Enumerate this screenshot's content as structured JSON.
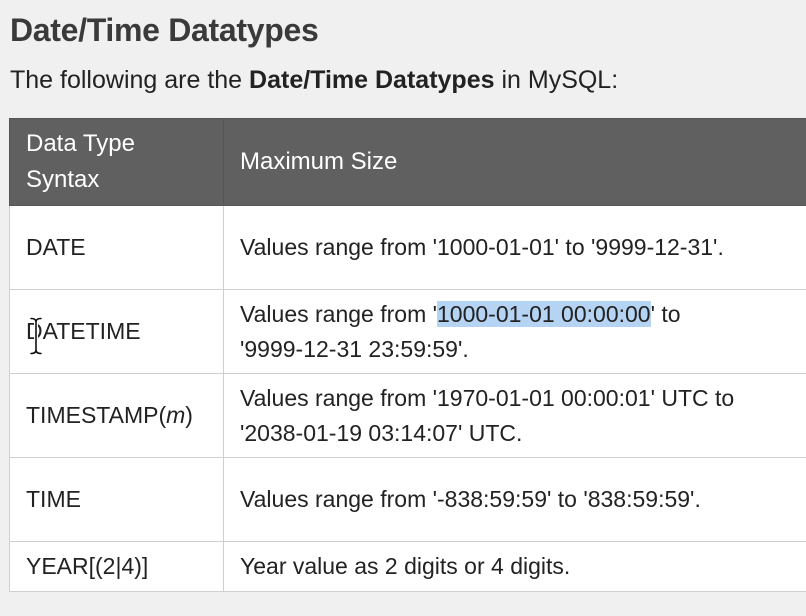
{
  "heading": "Date/Time Datatypes",
  "intro": {
    "prefix": "The following are the ",
    "bold": "Date/Time Datatypes",
    "suffix": " in MySQL:"
  },
  "table": {
    "headers": {
      "col1_line1": "Data Type",
      "col1_line2": "Syntax",
      "col2": "Maximum Size"
    },
    "rows": [
      {
        "type": "DATE",
        "desc_line1": "Values range from '1000-01-01' to '9999-12-31'."
      },
      {
        "type": "DATETIME",
        "desc_line1_pre": "Values range from '",
        "desc_line1_sel": "1000-01-01 00:00:00",
        "desc_line1_post": "' to",
        "desc_line2": "'9999-12-31 23:59:59'."
      },
      {
        "type_pre": "TIMESTAMP(",
        "type_italic": "m",
        "type_post": ")",
        "desc_line1": "Values range from '1970-01-01 00:00:01' UTC to",
        "desc_line2": "'2038-01-19 03:14:07' UTC."
      },
      {
        "type": "TIME",
        "desc_line1": "Values range from '-838:59:59' to '838:59:59'."
      },
      {
        "type": "YEAR[(2|4)]",
        "desc_line1": "Year value as 2 digits or 4 digits."
      }
    ]
  },
  "colors": {
    "header_bg": "#606060",
    "selection": "#b5d3f3",
    "page_bg": "#f0f0f0"
  },
  "cursor": "text-cursor-icon"
}
